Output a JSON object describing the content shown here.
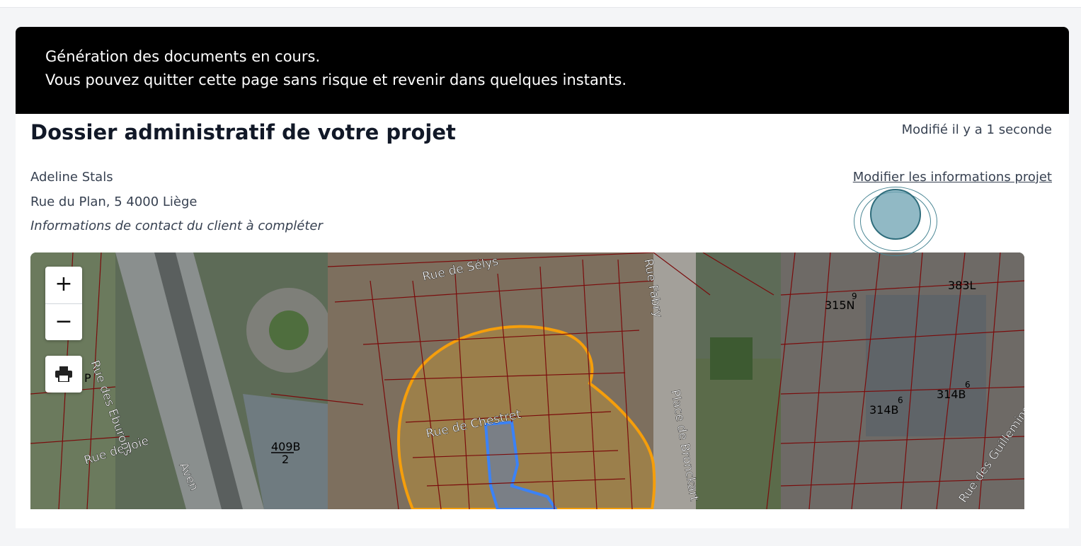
{
  "banner": {
    "line1": "Génération des documents en cours.",
    "line2": "Vous pouvez quitter cette page sans risque et revenir dans quelques instants."
  },
  "project": {
    "title": "Dossier administratif de votre projet",
    "modified": "Modifié il y a 1 seconde",
    "edit_link": "Modifier les informations projet"
  },
  "client": {
    "name": "Adeline Stals",
    "address": "Rue du Plan, 5 4000 Liège",
    "note": "Informations de contact du client à compléter"
  },
  "map": {
    "zoom_in": "+",
    "zoom_out": "−",
    "print_icon": "printer-icon",
    "streets": [
      "Rue de Sélys",
      "Rue des Eburons",
      "Rue de Joie",
      "Rue de Chestret",
      "Place de Bronckart",
      "Rue Fabry",
      "Rue des Guillemins",
      "Aven"
    ],
    "parcels": [
      "409B",
      "2",
      "315N",
      "9",
      "383L",
      "314B",
      "6",
      "314B",
      "6",
      "P"
    ],
    "colors": {
      "parcel_lines": "#7a0c0c",
      "buffer_zone": "#f59e0b",
      "project_parcel": "#3b82f6"
    }
  }
}
